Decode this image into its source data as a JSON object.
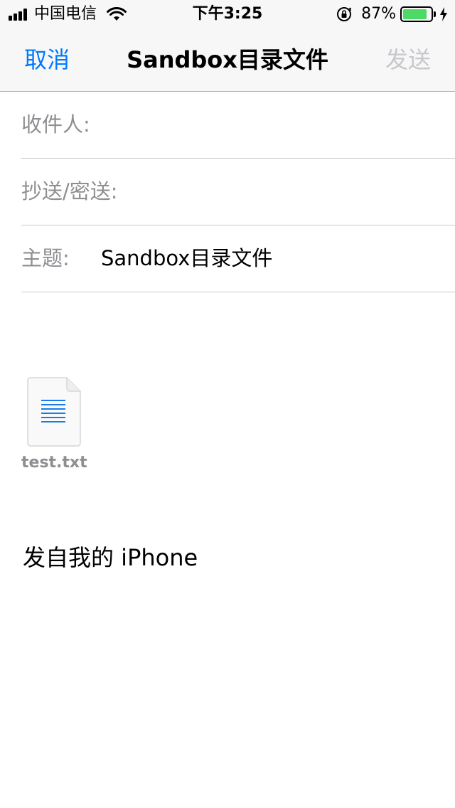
{
  "status_bar": {
    "carrier": "中国电信",
    "time": "下午3:25",
    "battery_percent": "87%",
    "battery_level": 0.87,
    "icons": [
      "signal-icon",
      "wifi-icon",
      "orientation-lock-icon",
      "battery-icon",
      "charging-bolt-icon"
    ]
  },
  "nav": {
    "cancel": "取消",
    "title": "Sandbox目录文件",
    "send": "发送",
    "accent_color": "#007aff",
    "disabled_color": "#c7c7cc"
  },
  "fields": {
    "to_label": "收件人:",
    "cc_bcc_label": "抄送/密送:",
    "subject_label": "主题:",
    "subject_value": "Sandbox目录文件"
  },
  "attachment": {
    "name": "test.txt",
    "icon": "text-document-icon"
  },
  "body": {
    "signature": "发自我的 iPhone"
  }
}
